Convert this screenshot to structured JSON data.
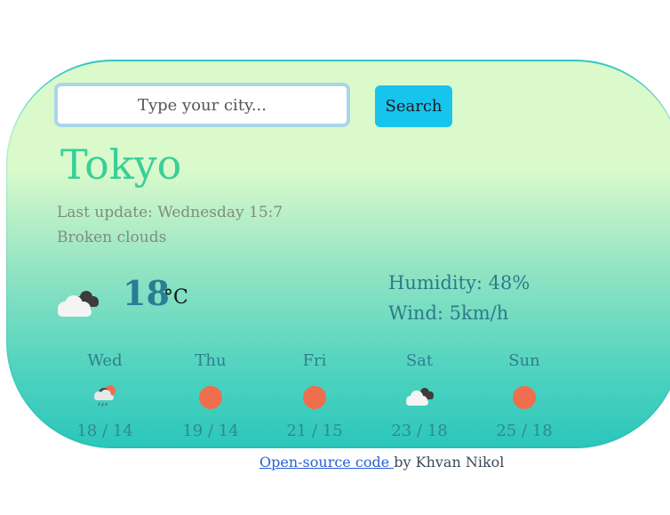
{
  "search": {
    "placeholder": "Type your city...",
    "button_label": "Search"
  },
  "current": {
    "city": "Tokyo",
    "last_update": "Last update: Wednesday 15:7",
    "description": "Broken clouds",
    "icon": "broken-clouds-icon",
    "temperature": "18",
    "unit": "°C",
    "humidity": "Humidity: 48%",
    "wind": "Wind: 5km/h"
  },
  "forecast": [
    {
      "day": "Wed",
      "icon": "rain-cloud-icon",
      "temps": "18 / 14"
    },
    {
      "day": "Thu",
      "icon": "sun-icon",
      "temps": "19 / 14"
    },
    {
      "day": "Fri",
      "icon": "sun-icon",
      "temps": "21 / 15"
    },
    {
      "day": "Sat",
      "icon": "broken-clouds-icon",
      "temps": "23 / 18"
    },
    {
      "day": "Sun",
      "icon": "sun-icon",
      "temps": "25 / 18"
    }
  ],
  "footer": {
    "link_text": "Open-source code ",
    "author_text": "by Khvan Nikol"
  },
  "colors": {
    "accent_button": "#17c4ee",
    "city_text": "#38cf98",
    "sun": "#ee6e4e"
  }
}
